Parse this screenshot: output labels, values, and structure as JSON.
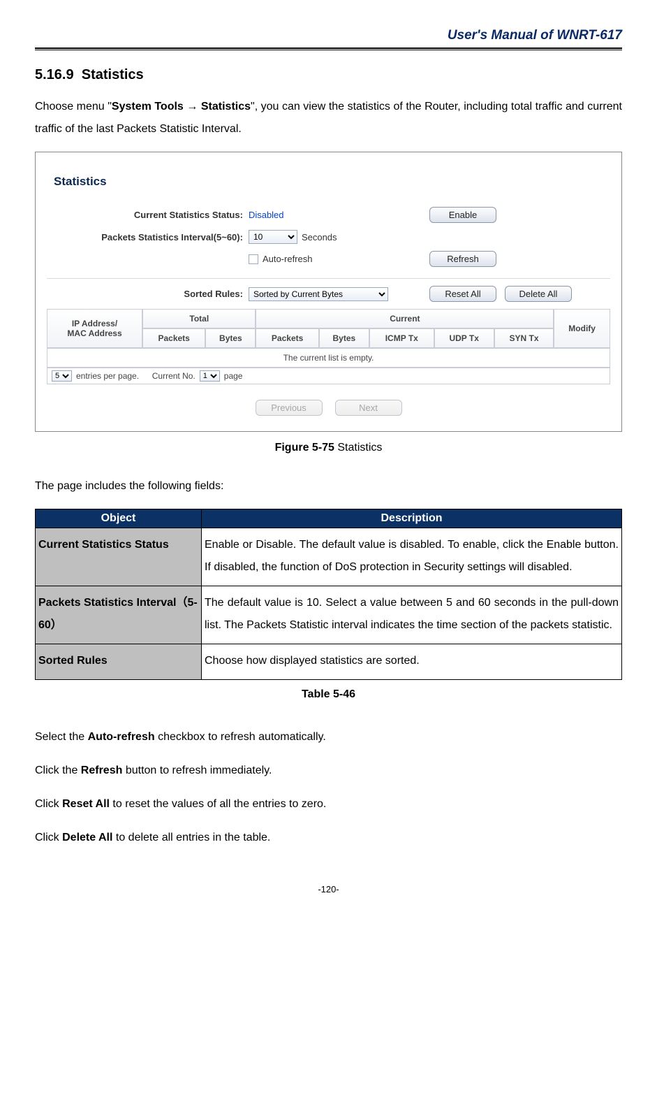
{
  "header": {
    "manual_title": "User's Manual of WNRT-617"
  },
  "section": {
    "number": "5.16.9",
    "title": "Statistics",
    "intro_1": "Choose menu \"",
    "intro_menu_1": "System Tools",
    "intro_arrow": " → ",
    "intro_menu_2": "Statistics",
    "intro_2": "\", you can view the statistics of the Router, including total traffic and current traffic of the last Packets Statistic Interval."
  },
  "figure": {
    "caption_bold": "Figure 5-75",
    "caption_rest": "    Statistics",
    "panel_title": "Statistics",
    "row1": {
      "label": "Current Statistics Status:",
      "value": "Disabled",
      "button": "Enable"
    },
    "row2": {
      "label": "Packets Statistics Interval(5~60):",
      "select_value": "10",
      "unit": "Seconds"
    },
    "row3": {
      "auto_refresh": "Auto-refresh",
      "refresh_btn": "Refresh"
    },
    "row4": {
      "label": "Sorted Rules:",
      "select_value": "Sorted by Current Bytes",
      "reset_btn": "Reset All",
      "delete_btn": "Delete All"
    },
    "grid": {
      "ip_mac": "IP Address/\nMAC Address",
      "total": "Total",
      "current": "Current",
      "packets": "Packets",
      "bytes": "Bytes",
      "icmp": "ICMP Tx",
      "udp": "UDP Tx",
      "syn": "SYN Tx",
      "modify": "Modify",
      "empty": "The current list is empty."
    },
    "footer": {
      "entries_select": "5",
      "entries_label": "entries per page.",
      "current_no": "Current No.",
      "page_select": "1",
      "page_label": "page"
    },
    "pager": {
      "prev": "Previous",
      "next": "Next"
    }
  },
  "fields_intro": "The page includes the following fields:",
  "obj_table": {
    "h_object": "Object",
    "h_desc": "Description",
    "r1": {
      "obj": "Current Statistics Status",
      "d1": "Enable or Disable. The default value is disabled. To enable, click the ",
      "d_bold": "Enable",
      "d2": " button. If disabled, the function of DoS protection in Security settings will disabled."
    },
    "r2": {
      "obj": "Packets Statistics Interval（5-60）",
      "desc": "The default value is 10. Select a value between 5 and 60 seconds in the pull-down list. The Packets Statistic interval indicates the time section of the packets statistic."
    },
    "r3": {
      "obj": "Sorted Rules",
      "desc": "Choose how displayed statistics are sorted."
    }
  },
  "table_caption": "Table 5-46",
  "notes": {
    "n1a": "Select the ",
    "n1b": "Auto-refresh",
    "n1c": " checkbox to refresh automatically.",
    "n2a": "Click the ",
    "n2b": "Refresh",
    "n2c": " button to refresh immediately.",
    "n3a": "Click ",
    "n3b": "Reset All",
    "n3c": " to reset the values of all the entries to zero.",
    "n4a": "Click ",
    "n4b": "Delete All",
    "n4c": " to delete all entries in the table."
  },
  "page_number": "-120-"
}
